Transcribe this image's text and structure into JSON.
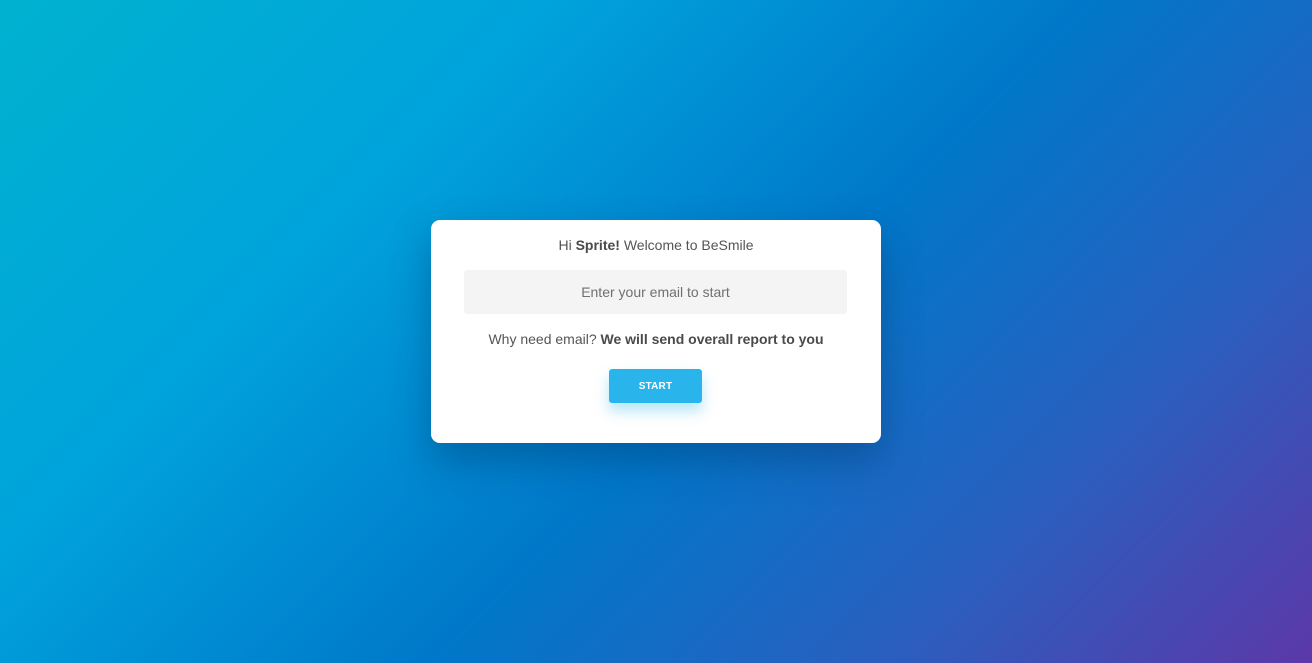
{
  "welcome": {
    "prefix": "Hi",
    "name": "Sprite!",
    "suffix": "Welcome to BeSmile"
  },
  "email": {
    "placeholder": "Enter your email to start",
    "value": ""
  },
  "info": {
    "question": "Why need email?",
    "answer": "We will send overall report to you"
  },
  "start_button": {
    "label": "START"
  },
  "colors": {
    "accent": "#2ab4ec",
    "background_start": "#00b2cf",
    "background_end": "#5c38a8"
  }
}
